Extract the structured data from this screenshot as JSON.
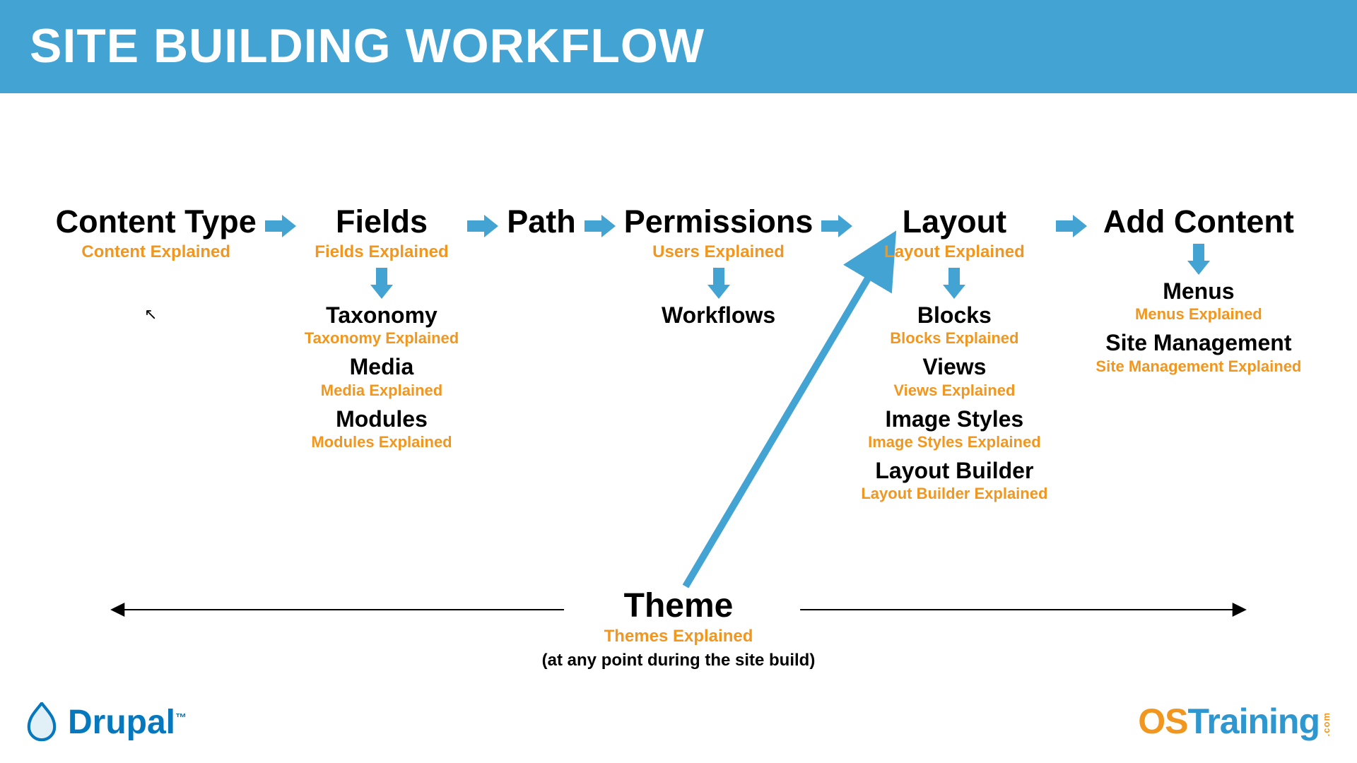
{
  "header": {
    "title": "SITE BUILDING WORKFLOW"
  },
  "steps": [
    {
      "title": "Content Type",
      "sub": "Content Explained",
      "children": []
    },
    {
      "title": "Fields",
      "sub": "Fields Explained",
      "children": [
        {
          "t": "Taxonomy",
          "s": "Taxonomy Explained"
        },
        {
          "t": "Media",
          "s": "Media Explained"
        },
        {
          "t": "Modules",
          "s": "Modules Explained"
        }
      ]
    },
    {
      "title": "Path",
      "sub": "",
      "children": []
    },
    {
      "title": "Permissions",
      "sub": "Users Explained",
      "children": [
        {
          "t": "Workflows",
          "s": ""
        }
      ]
    },
    {
      "title": "Layout",
      "sub": "Layout Explained",
      "children": [
        {
          "t": "Blocks",
          "s": "Blocks Explained"
        },
        {
          "t": "Views",
          "s": "Views Explained"
        },
        {
          "t": "Image Styles",
          "s": "Image Styles Explained"
        },
        {
          "t": "Layout Builder",
          "s": "Layout Builder Explained"
        }
      ]
    },
    {
      "title": "Add Content",
      "sub": "",
      "children": [
        {
          "t": "Menus",
          "s": "Menus Explained"
        },
        {
          "t": "Site Management",
          "s": "Site Management Explained"
        }
      ]
    }
  ],
  "theme": {
    "title": "Theme",
    "sub": "Themes Explained",
    "note": "(at any point during the site build)"
  },
  "footer": {
    "drupal": "Drupal",
    "tm": "™",
    "ost_a": "OS",
    "ost_b": "Training",
    "ost_c": ".com"
  },
  "colors": {
    "accent": "#43a3d3",
    "orange": "#f1961e",
    "drupal": "#0678be"
  }
}
